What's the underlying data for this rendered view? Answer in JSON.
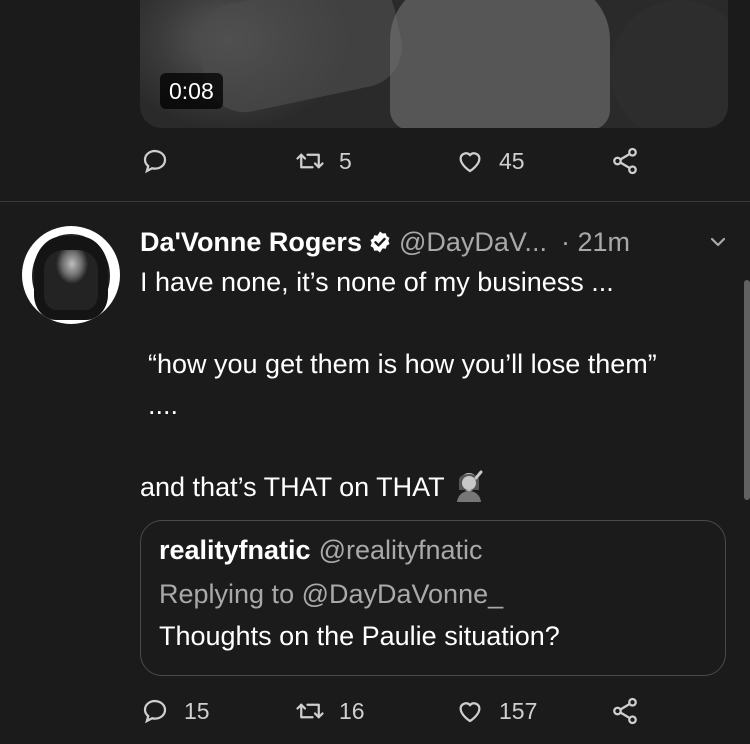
{
  "top_tweet": {
    "video": {
      "duration": "0:08"
    },
    "actions": {
      "reply_count": "",
      "retweet_count": "5",
      "like_count": "45"
    }
  },
  "tweet": {
    "author_name": "Da'Vonne Rogers",
    "handle": "@DayDaV...",
    "time": "· 21m",
    "verified": true,
    "lines": [
      "I have none, it’s none of my business ...",
      "“how you get them is how you’ll lose them” ....",
      "and that’s THAT on THAT"
    ],
    "emoji": "woman-shrugging-icon",
    "quote": {
      "name": "realityfnatic",
      "handle": "@realityfnatic",
      "replying": "Replying to @DayDaVonne_",
      "text": "Thoughts on the Paulie situation?"
    },
    "actions": {
      "reply_count": "15",
      "retweet_count": "16",
      "like_count": "157"
    }
  },
  "colors": {
    "background": "#1b1b1b",
    "text": "#ffffff",
    "secondary": "#a9a9a9",
    "divider": "#3a3a3a"
  }
}
